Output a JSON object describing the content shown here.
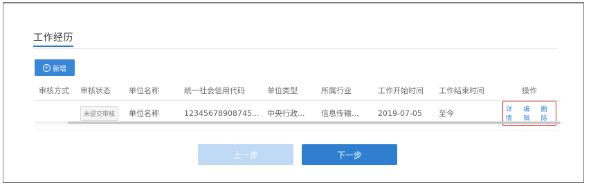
{
  "section": {
    "title": "工作经历"
  },
  "toolbar": {
    "add_icon": "plus-circle-icon",
    "add_label": "新增"
  },
  "table": {
    "columns": [
      "审核方式",
      "审核状态",
      "单位名称",
      "统一社会信用代码",
      "单位类型",
      "所属行业",
      "工作开始时间",
      "工作结束时间",
      "操作"
    ],
    "rows": [
      {
        "audit_method": "",
        "audit_status": "未提交审核",
        "unit_name": "单位名称",
        "credit_code": "12345678908745...",
        "unit_type": "中央行政...",
        "industry": "信息传输...",
        "start_date": "2019-07-05",
        "end_date": "至今",
        "actions": {
          "detail": "详情",
          "edit": "编辑",
          "delete": "删除"
        }
      }
    ]
  },
  "footer": {
    "prev_label": "上一步",
    "next_label": "下一步"
  },
  "colors": {
    "primary": "#2f7fd1",
    "primary_light": "#c0d9f5",
    "highlight_border": "#d9202a"
  }
}
